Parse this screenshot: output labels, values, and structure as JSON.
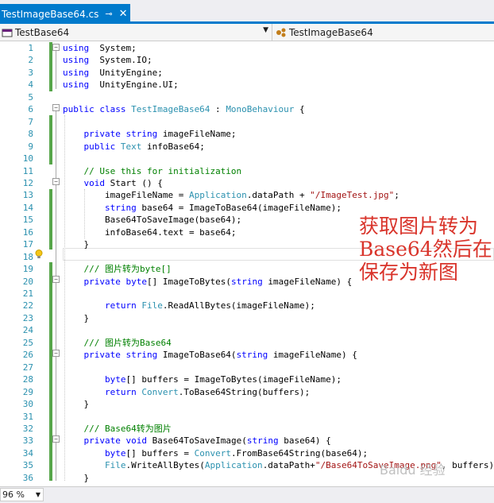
{
  "tab": {
    "filename": "TestImageBase64.cs",
    "pin_glyph": "⊸",
    "close_glyph": "✕"
  },
  "nav": {
    "left_label": "TestBase64",
    "right_label": "TestImageBase64"
  },
  "code_lines": [
    {
      "n": "1"
    },
    {
      "n": "2"
    },
    {
      "n": "3"
    },
    {
      "n": "4"
    },
    {
      "n": "5"
    },
    {
      "n": "6"
    },
    {
      "n": "7"
    },
    {
      "n": "8"
    },
    {
      "n": "9"
    },
    {
      "n": "10"
    },
    {
      "n": "11"
    },
    {
      "n": "12"
    },
    {
      "n": "13"
    },
    {
      "n": "14"
    },
    {
      "n": "15"
    },
    {
      "n": "16"
    },
    {
      "n": "17"
    },
    {
      "n": "18"
    },
    {
      "n": "19"
    },
    {
      "n": "20"
    },
    {
      "n": "21"
    },
    {
      "n": "22"
    },
    {
      "n": "23"
    },
    {
      "n": "24"
    },
    {
      "n": "25"
    },
    {
      "n": "26"
    },
    {
      "n": "27"
    },
    {
      "n": "28"
    },
    {
      "n": "29"
    },
    {
      "n": "30"
    },
    {
      "n": "31"
    },
    {
      "n": "32"
    },
    {
      "n": "33"
    },
    {
      "n": "34"
    },
    {
      "n": "35"
    },
    {
      "n": "36"
    }
  ],
  "code": {
    "l1": [
      [
        "kw",
        "using"
      ],
      [
        "",
        "  System;"
      ]
    ],
    "l2": [
      [
        "kw",
        "using"
      ],
      [
        "",
        "  System.IO;"
      ]
    ],
    "l3": [
      [
        "kw",
        "using"
      ],
      [
        "",
        "  UnityEngine;"
      ]
    ],
    "l4": [
      [
        "kw",
        "using"
      ],
      [
        "",
        "  UnityEngine.UI;"
      ]
    ],
    "l6": [
      [
        "kw",
        "public class "
      ],
      [
        "ty",
        "TestImageBase64"
      ],
      [
        "",
        " : "
      ],
      [
        "ty",
        "MonoBehaviour"
      ],
      [
        "",
        " {"
      ]
    ],
    "l8": [
      [
        "",
        "    "
      ],
      [
        "kw",
        "private string"
      ],
      [
        "",
        " imageFileName;"
      ]
    ],
    "l9": [
      [
        "",
        "    "
      ],
      [
        "kw",
        "public "
      ],
      [
        "ty",
        "Text"
      ],
      [
        "",
        " infoBase64;"
      ]
    ],
    "l11": [
      [
        "",
        "    "
      ],
      [
        "cm",
        "// Use this for initialization"
      ]
    ],
    "l12": [
      [
        "",
        "    "
      ],
      [
        "kw",
        "void"
      ],
      [
        "",
        " Start () {"
      ]
    ],
    "l13": [
      [
        "",
        "        imageFileName = "
      ],
      [
        "ty",
        "Application"
      ],
      [
        "",
        ".dataPath + "
      ],
      [
        "st",
        "\"/ImageTest.jpg\""
      ],
      [
        "",
        ";"
      ]
    ],
    "l14": [
      [
        "",
        "        "
      ],
      [
        "kw",
        "string"
      ],
      [
        "",
        " base64 = ImageToBase64(imageFileName);"
      ]
    ],
    "l15": [
      [
        "",
        "        Base64ToSaveImage(base64);"
      ]
    ],
    "l16": [
      [
        "",
        "        infoBase64.text = base64;"
      ]
    ],
    "l17": [
      [
        "",
        "    }"
      ]
    ],
    "l19": [
      [
        "",
        "    "
      ],
      [
        "cm",
        "/// 图片转为byte[]"
      ]
    ],
    "l20": [
      [
        "",
        "    "
      ],
      [
        "kw",
        "private byte"
      ],
      [
        "",
        "[] ImageToBytes("
      ],
      [
        "kw",
        "string"
      ],
      [
        "",
        " imageFileName) {"
      ]
    ],
    "l22": [
      [
        "",
        "        "
      ],
      [
        "kw",
        "return "
      ],
      [
        "ty",
        "File"
      ],
      [
        "",
        ".ReadAllBytes(imageFileName);"
      ]
    ],
    "l23": [
      [
        "",
        "    }"
      ]
    ],
    "l25": [
      [
        "",
        "    "
      ],
      [
        "cm",
        "/// 图片转为Base64"
      ]
    ],
    "l26": [
      [
        "",
        "    "
      ],
      [
        "kw",
        "private string"
      ],
      [
        "",
        " ImageToBase64("
      ],
      [
        "kw",
        "string"
      ],
      [
        "",
        " imageFileName) {"
      ]
    ],
    "l28": [
      [
        "",
        "        "
      ],
      [
        "kw",
        "byte"
      ],
      [
        "",
        "[] buffers = ImageToBytes(imageFileName);"
      ]
    ],
    "l29": [
      [
        "",
        "        "
      ],
      [
        "kw",
        "return "
      ],
      [
        "ty",
        "Convert"
      ],
      [
        "",
        ".ToBase64String(buffers);"
      ]
    ],
    "l30": [
      [
        "",
        "    }"
      ]
    ],
    "l32": [
      [
        "",
        "    "
      ],
      [
        "cm",
        "/// Base64转为图片"
      ]
    ],
    "l33": [
      [
        "",
        "    "
      ],
      [
        "kw",
        "private void"
      ],
      [
        "",
        " Base64ToSaveImage("
      ],
      [
        "kw",
        "string"
      ],
      [
        "",
        " base64) {"
      ]
    ],
    "l34": [
      [
        "",
        "        "
      ],
      [
        "kw",
        "byte"
      ],
      [
        "",
        "[] buffers = "
      ],
      [
        "ty",
        "Convert"
      ],
      [
        "",
        ".FromBase64String(base64);"
      ]
    ],
    "l35": [
      [
        "",
        "        "
      ],
      [
        "ty",
        "File"
      ],
      [
        "",
        ".WriteAllBytes("
      ],
      [
        "ty",
        "Application"
      ],
      [
        "",
        ".dataPath+"
      ],
      [
        "st",
        "\"/Base64ToSaveImage.png\""
      ],
      [
        "",
        ", buffers);"
      ]
    ],
    "l36": [
      [
        "",
        "    }"
      ]
    ],
    "l37": [
      [
        "",
        "}"
      ]
    ]
  },
  "overlay": {
    "text": "获取图片转为Base64然后在保存为新图"
  },
  "status": {
    "zoom": "96 %"
  },
  "watermark": {
    "text": "Baidu 经验"
  }
}
